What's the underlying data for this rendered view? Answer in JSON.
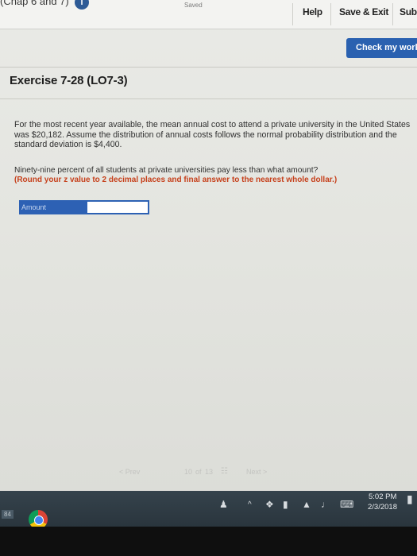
{
  "header": {
    "chapter_label": "(Chap 6 and 7)",
    "info_badge": "i",
    "saved_status": "Saved",
    "help_label": "Help",
    "save_exit_label": "Save & Exit",
    "submit_label": "Sub"
  },
  "check_work_label": "Check my work",
  "exercise": {
    "title": "Exercise 7-28 (LO7-3)",
    "problem": "For the most recent year available, the mean annual cost to attend a private university in the United States was $20,182. Assume the distribution of annual costs follows the normal probability distribution and the standard deviation is $4,400.",
    "question": "Ninety-nine percent of all students at private universities pay less than what amount?",
    "instruction": "(Round your z value to 2 decimal places and final answer to the nearest whole dollar.)",
    "answer_label": "Amount",
    "answer_value": ""
  },
  "pagination": {
    "prev_label": "< Prev",
    "page_current": "10",
    "page_of": "of",
    "page_total": "13",
    "next_label": "Next >"
  },
  "taskbar": {
    "time": "5:02 PM",
    "date": "2/3/2018",
    "start_badge": "84"
  }
}
